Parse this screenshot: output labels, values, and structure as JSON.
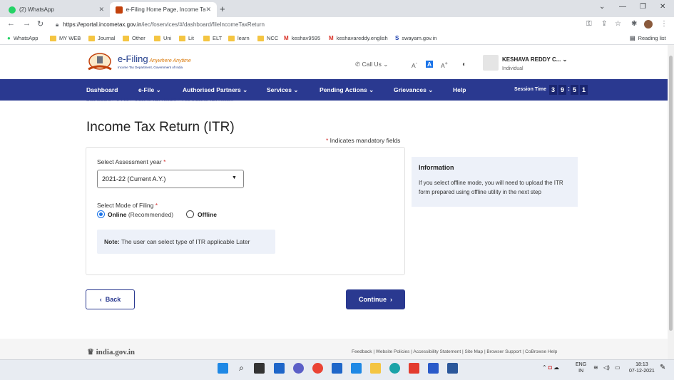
{
  "browser": {
    "tabs": [
      {
        "label": "(2) WhatsApp",
        "active": false
      },
      {
        "label": "e-Filing Home Page, Income Tax",
        "active": true
      }
    ],
    "url_host": "https://eportal.incometax.gov.in",
    "url_path": "/iec/foservices/#/dashboard/fileIncomeTaxReturn",
    "bookmarks": [
      "WhatsApp",
      "MY WEB",
      "Journal",
      "Other",
      "Uni",
      "Lit",
      "ELT",
      "learn",
      "NCC",
      "keshav9595",
      "keshavareddy.english",
      "swayam.gov.in"
    ],
    "reading_list": "Reading list"
  },
  "header": {
    "logo_title": "e-Filing",
    "logo_tagline": "Anywhere Anytime",
    "logo_sub": "Income Tax Department, Government of India",
    "call_us": "Call Us",
    "font_small": "A",
    "font_mid": "A",
    "font_large": "A",
    "user_name": "KESHAVA REDDY C...",
    "user_role": "Individual"
  },
  "navbar": {
    "items": [
      "Dashboard",
      "e-File",
      "Authorised Partners",
      "Services",
      "Pending Actions",
      "Grievances",
      "Help"
    ],
    "session_label": "Session Time",
    "timer": [
      "3",
      "9",
      "5",
      "1"
    ]
  },
  "main": {
    "breadcrumb": "Dashboard  >  e-File  >  Income Tax Return  >  File Income Tax Return",
    "title": "Income Tax Return (ITR)",
    "mandatory_note": "Indicates mandatory fields",
    "ay_label": "Select Assessment year",
    "ay_value": "2021-22  (Current A.Y.)",
    "mode_label": "Select Mode of Filing",
    "online_label": "Online",
    "online_sub": "(Recommended)",
    "offline_label": "Offline",
    "note_prefix": "Note:",
    "note_text": "The user can select type of ITR applicable Later",
    "info_title": "Information",
    "info_text": "If you select offline mode, you will need to upload the ITR form prepared using offline utility in the next step",
    "back_label": "Back",
    "continue_label": "Continue"
  },
  "footer": {
    "india_gov": "india.gov.in",
    "links": "Feedback | Website Policies | Accessibility Statement | Site Map | Browser Support | CoBrowse Help"
  },
  "taskbar": {
    "lang": "ENG",
    "region": "IN",
    "time": "18:13",
    "date": "07-12-2021"
  },
  "colors": {
    "navbar": "#2a3990",
    "primary_button": "#2a3990",
    "info_bg": "#edf1f9",
    "radio_selected": "#1a73e8"
  }
}
